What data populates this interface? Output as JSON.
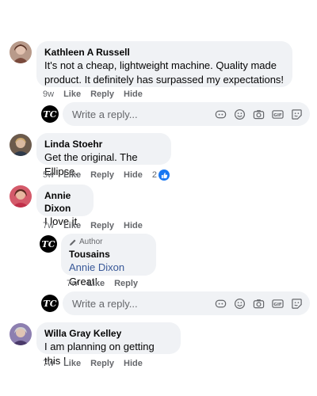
{
  "comments": [
    {
      "author": "Kathleen A Russell",
      "text_line1": "It's not a cheap, lightweight machine. Quality made",
      "text_line2": "product. It definitely has surpassed my expectations!",
      "time": "9w",
      "like": "Like",
      "reply": "Reply",
      "hide": "Hide"
    },
    {
      "author": "Linda Stoehr",
      "text": "Get the original. The Ellipse.",
      "time": "5w",
      "like": "Like",
      "reply": "Reply",
      "hide": "Hide",
      "reaction_count": "2"
    },
    {
      "author": "Annie Dixon",
      "text": "I love it",
      "time": "7w",
      "like": "Like",
      "reply": "Reply",
      "hide": "Hide"
    },
    {
      "author": "Willa Gray Kelley",
      "text": "I am planning on getting this !",
      "time": "7w",
      "like": "Like",
      "reply": "Reply",
      "hide": "Hide"
    }
  ],
  "nested_reply": {
    "badge": "Author",
    "author": "Tousains",
    "mention": "Annie Dixon",
    "text": " Great!",
    "time": "7w",
    "like": "Like",
    "reply": "Reply"
  },
  "reply_box": {
    "placeholder": "Write a reply...",
    "icons": [
      "sticker-icon",
      "emoji-icon",
      "camera-icon",
      "gif-icon",
      "sticker-face-icon"
    ]
  },
  "brand_logo_text": "TC",
  "colors": {
    "bubble": "#f0f2f5",
    "muted": "#65676b",
    "like_blue": "#1877f2",
    "mention": "#385898"
  }
}
